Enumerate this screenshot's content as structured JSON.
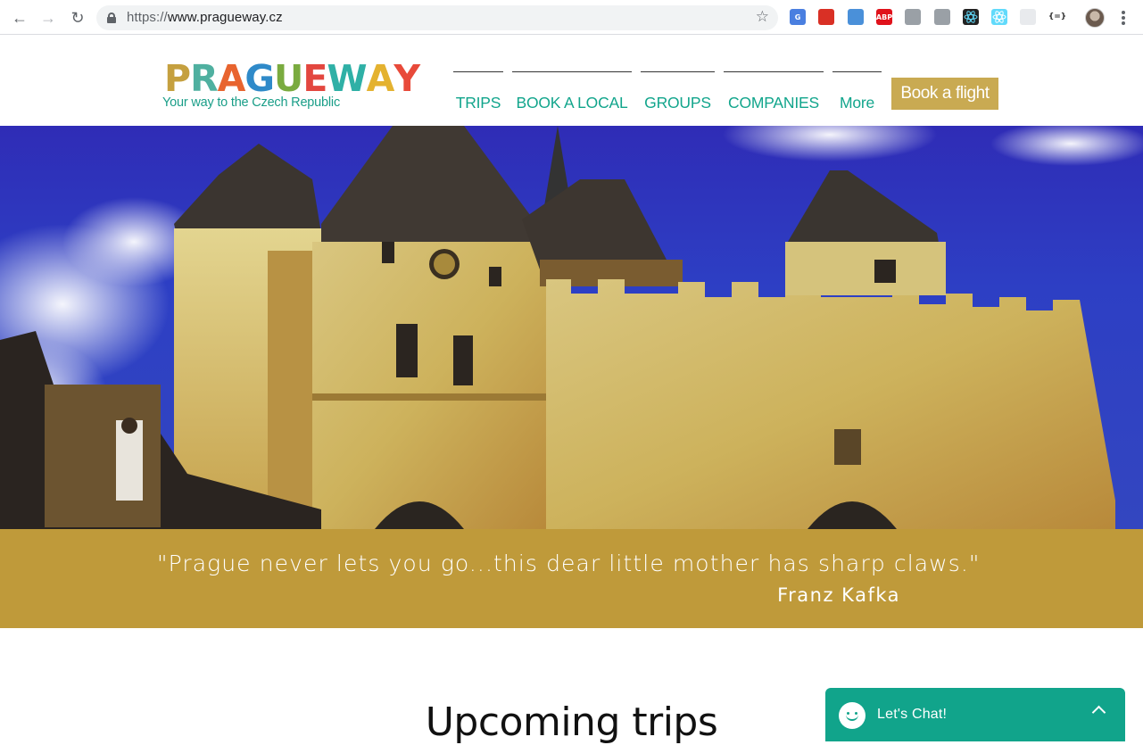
{
  "browser": {
    "url_scheme": "https://",
    "url_host": "www.pragueway.cz",
    "icons": {
      "back": "arrow-left",
      "forward": "arrow-right",
      "reload": "reload",
      "bookmark": "star"
    },
    "extensions": [
      {
        "name": "google-translate-icon",
        "label": "G",
        "color": "#4a7fe0"
      },
      {
        "name": "red-extension-icon",
        "label": "",
        "color": "#d93025"
      },
      {
        "name": "print-extension-icon",
        "label": "",
        "color": "#4a90d9"
      },
      {
        "name": "adblock-plus-icon",
        "label": "ABP",
        "color": "#e0121b"
      },
      {
        "name": "drive-icon",
        "label": "",
        "color": "#9aa0a6"
      },
      {
        "name": "android-icon",
        "label": "",
        "color": "#9aa0a6"
      },
      {
        "name": "react-devtools-icon",
        "label": "",
        "color": "#222"
      },
      {
        "name": "react-icon",
        "label": "",
        "color": "#61dafb"
      },
      {
        "name": "grey-circle-icon",
        "label": "",
        "color": "#e8eaed"
      },
      {
        "name": "json-formatter-icon",
        "label": "{=}",
        "color": "#fff"
      }
    ]
  },
  "site": {
    "logo_letters": [
      {
        "ch": "P",
        "color": "#c5a03f"
      },
      {
        "ch": "R",
        "color": "#4fb0a0"
      },
      {
        "ch": "A",
        "color": "#e8642f"
      },
      {
        "ch": "G",
        "color": "#2f8ac9"
      },
      {
        "ch": "U",
        "color": "#7aab3f"
      },
      {
        "ch": "E",
        "color": "#e3473f"
      },
      {
        "ch": "W",
        "color": "#2fb0a6"
      },
      {
        "ch": "A",
        "color": "#e4b230"
      },
      {
        "ch": "Y",
        "color": "#e84a3a"
      }
    ],
    "tagline": "Your way to the Czech Republic",
    "menu": [
      "TRIPS",
      "BOOK A LOCAL",
      "GROUPS",
      "COMPANIES",
      "More"
    ],
    "book_button": "Book a flight",
    "accent_color": "#12a58c",
    "gold_color": "#c9aa52"
  },
  "quote": {
    "text": "\"Prague never lets you go...this dear little mother has sharp claws.\"",
    "author": "Franz Kafka"
  },
  "section": {
    "title": "Upcoming trips"
  },
  "chat": {
    "label": "Let's Chat!",
    "icon": "smiley-face-icon"
  }
}
